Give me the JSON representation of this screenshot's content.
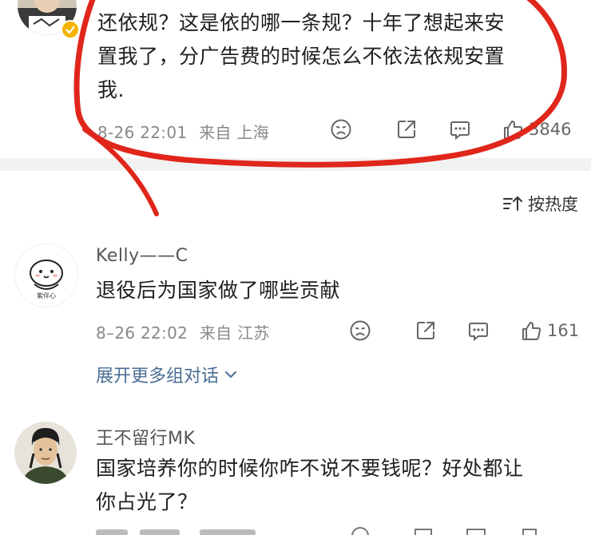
{
  "comments": [
    {
      "text": "还依规？这是依的哪一条规？十年了想起来安置我了，分广告费的时候怎么不依法依规安置我.",
      "text_line1": "还依规？这是依的哪一条规？十年了想起来安",
      "text_line2": "置我了，分广告费的时候怎么不依法依规安置",
      "text_line3": "我.",
      "timestamp": "8-26 22:01",
      "location": "来自 上海",
      "likes": "3846"
    },
    {
      "username": "Kelly——C",
      "avatar_caption": "紫伴心",
      "text": "退役后为国家做了哪些贡献",
      "timestamp": "8–26 22:02",
      "location": "来自 江苏",
      "likes": "161",
      "expand_label": "展开更多组对话"
    },
    {
      "username": "王不留行MK",
      "text": "国家培养你的时候你咋不说不要钱呢？好处都让你占光了？",
      "text_line1": "国家培养你的时候你咋不说不要钱呢？好处都让",
      "text_line2": "你占光了？"
    }
  ],
  "sort": {
    "label": "按热度"
  },
  "colors": {
    "annotation_red": "#e0261b",
    "link_blue": "#4a6d94",
    "meta_gray": "#888888",
    "divider": "#f2f2f2"
  },
  "icons": [
    "dislike-icon",
    "share-icon",
    "comment-icon",
    "like-icon",
    "sort-icon",
    "chevron-down-icon",
    "verified-badge-icon"
  ]
}
